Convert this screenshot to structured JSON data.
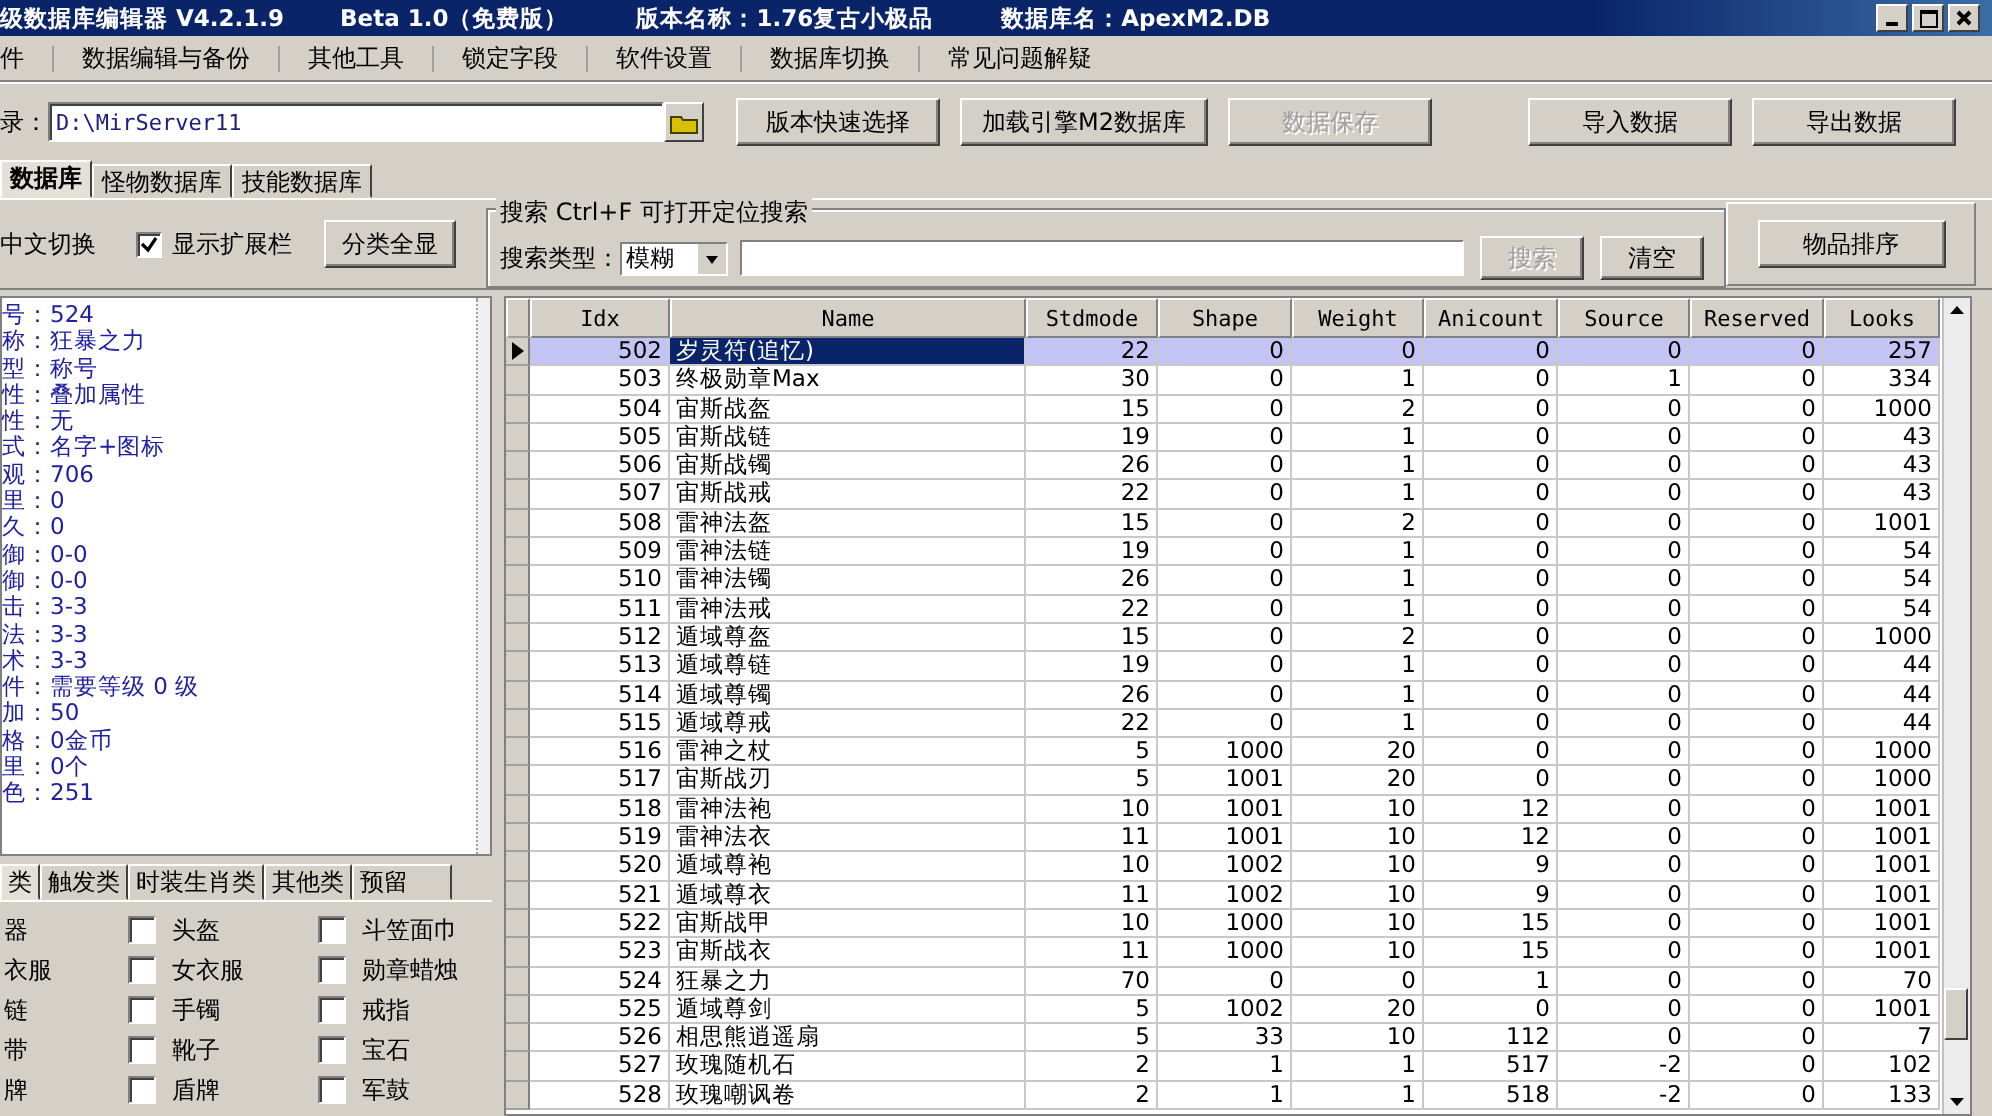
{
  "window": {
    "title_parts": [
      "级数据库编辑器 V4.2.1.9",
      "Beta 1.0（免费版）",
      "版本名称：1.76复古小极品",
      "数据库名：ApexM2.DB"
    ]
  },
  "menu": [
    "件",
    "数据编辑与备份",
    "其他工具",
    "锁定字段",
    "软件设置",
    "数据库切换",
    "常见问题解疑"
  ],
  "toolbar": {
    "path_label": "录：",
    "path_value": "D:\\MirServer11",
    "buttons": [
      {
        "label": "版本快速选择",
        "disabled": false
      },
      {
        "label": "加载引擎M2数据库",
        "disabled": false
      },
      {
        "label": "数据保存",
        "disabled": true
      }
    ],
    "right_buttons": [
      {
        "label": "导入数据",
        "disabled": false
      },
      {
        "label": "导出数据",
        "disabled": false
      }
    ]
  },
  "tabs": [
    {
      "label": "数据库",
      "selected": true
    },
    {
      "label": "怪物数据库",
      "selected": false
    },
    {
      "label": "技能数据库",
      "selected": false
    }
  ],
  "options": {
    "chinese_toggle": "中文切换",
    "show_ext": {
      "label": "显示扩展栏",
      "checked": true
    },
    "show_all_button": "分类全显"
  },
  "search": {
    "title": "搜索  Ctrl+F 可打开定位搜索",
    "type_label": "搜索类型：",
    "type_value": "模糊",
    "search_button": {
      "label": "搜索",
      "disabled": true
    },
    "clear_button": {
      "label": "清空",
      "disabled": false
    },
    "sort_button": "物品排序"
  },
  "info": [
    "号：524",
    "称：狂暴之力",
    "型：称号",
    "性：叠加属性",
    "性：无",
    "式：名字+图标",
    "观：706",
    "里：0",
    "久：0",
    "御：0-0",
    "御：0-0",
    "击：3-3",
    "法：3-3",
    "术：3-3",
    "件：需要等级 0 级",
    "加：50",
    "格：0金币",
    "里：0个",
    "色：251"
  ],
  "category_tabs": [
    {
      "label": "类",
      "selected": true
    },
    {
      "label": "触发类",
      "selected": false
    },
    {
      "label": "时装生肖类",
      "selected": false
    },
    {
      "label": "其他类",
      "selected": false
    },
    {
      "label": "预留",
      "selected": false
    }
  ],
  "categories": [
    {
      "label": "器"
    },
    {
      "label": "头盔",
      "checked": false
    },
    {
      "label": "斗笠面巾",
      "checked": false
    },
    {
      "label": "衣服"
    },
    {
      "label": "女衣服",
      "checked": false
    },
    {
      "label": "勋章蜡烛",
      "checked": false
    },
    {
      "label": "链"
    },
    {
      "label": "手镯",
      "checked": false
    },
    {
      "label": "戒指",
      "checked": false
    },
    {
      "label": "带"
    },
    {
      "label": "靴子",
      "checked": false
    },
    {
      "label": "宝石",
      "checked": false
    },
    {
      "label": "牌"
    },
    {
      "label": "盾牌",
      "checked": false
    },
    {
      "label": "军鼓",
      "checked": false
    }
  ],
  "table": {
    "columns": [
      "Idx",
      "Name",
      "Stdmode",
      "Shape",
      "Weight",
      "Anicount",
      "Source",
      "Reserved",
      "Looks"
    ],
    "rows": [
      {
        "selected": true,
        "cells": [
          "502",
          "岁灵符(追忆)",
          "22",
          "0",
          "0",
          "0",
          "0",
          "0",
          "257"
        ]
      },
      {
        "selected": false,
        "cells": [
          "503",
          "终极勋章Max",
          "30",
          "0",
          "1",
          "0",
          "1",
          "0",
          "334"
        ]
      },
      {
        "selected": false,
        "cells": [
          "504",
          "宙斯战盔",
          "15",
          "0",
          "2",
          "0",
          "0",
          "0",
          "1000"
        ]
      },
      {
        "selected": false,
        "cells": [
          "505",
          "宙斯战链",
          "19",
          "0",
          "1",
          "0",
          "0",
          "0",
          "43"
        ]
      },
      {
        "selected": false,
        "cells": [
          "506",
          "宙斯战镯",
          "26",
          "0",
          "1",
          "0",
          "0",
          "0",
          "43"
        ]
      },
      {
        "selected": false,
        "cells": [
          "507",
          "宙斯战戒",
          "22",
          "0",
          "1",
          "0",
          "0",
          "0",
          "43"
        ]
      },
      {
        "selected": false,
        "cells": [
          "508",
          "雷神法盔",
          "15",
          "0",
          "2",
          "0",
          "0",
          "0",
          "1001"
        ]
      },
      {
        "selected": false,
        "cells": [
          "509",
          "雷神法链",
          "19",
          "0",
          "1",
          "0",
          "0",
          "0",
          "54"
        ]
      },
      {
        "selected": false,
        "cells": [
          "510",
          "雷神法镯",
          "26",
          "0",
          "1",
          "0",
          "0",
          "0",
          "54"
        ]
      },
      {
        "selected": false,
        "cells": [
          "511",
          "雷神法戒",
          "22",
          "0",
          "1",
          "0",
          "0",
          "0",
          "54"
        ]
      },
      {
        "selected": false,
        "cells": [
          "512",
          "遁域尊盔",
          "15",
          "0",
          "2",
          "0",
          "0",
          "0",
          "1000"
        ]
      },
      {
        "selected": false,
        "cells": [
          "513",
          "遁域尊链",
          "19",
          "0",
          "1",
          "0",
          "0",
          "0",
          "44"
        ]
      },
      {
        "selected": false,
        "cells": [
          "514",
          "遁域尊镯",
          "26",
          "0",
          "1",
          "0",
          "0",
          "0",
          "44"
        ]
      },
      {
        "selected": false,
        "cells": [
          "515",
          "遁域尊戒",
          "22",
          "0",
          "1",
          "0",
          "0",
          "0",
          "44"
        ]
      },
      {
        "selected": false,
        "cells": [
          "516",
          "雷神之杖",
          "5",
          "1000",
          "20",
          "0",
          "0",
          "0",
          "1000"
        ]
      },
      {
        "selected": false,
        "cells": [
          "517",
          "宙斯战刃",
          "5",
          "1001",
          "20",
          "0",
          "0",
          "0",
          "1000"
        ]
      },
      {
        "selected": false,
        "cells": [
          "518",
          "雷神法袍",
          "10",
          "1001",
          "10",
          "12",
          "0",
          "0",
          "1001"
        ]
      },
      {
        "selected": false,
        "cells": [
          "519",
          "雷神法衣",
          "11",
          "1001",
          "10",
          "12",
          "0",
          "0",
          "1001"
        ]
      },
      {
        "selected": false,
        "cells": [
          "520",
          "遁域尊袍",
          "10",
          "1002",
          "10",
          "9",
          "0",
          "0",
          "1001"
        ]
      },
      {
        "selected": false,
        "cells": [
          "521",
          "遁域尊衣",
          "11",
          "1002",
          "10",
          "9",
          "0",
          "0",
          "1001"
        ]
      },
      {
        "selected": false,
        "cells": [
          "522",
          "宙斯战甲",
          "10",
          "1000",
          "10",
          "15",
          "0",
          "0",
          "1001"
        ]
      },
      {
        "selected": false,
        "cells": [
          "523",
          "宙斯战衣",
          "11",
          "1000",
          "10",
          "15",
          "0",
          "0",
          "1001"
        ]
      },
      {
        "selected": false,
        "cells": [
          "524",
          "狂暴之力",
          "70",
          "0",
          "0",
          "1",
          "0",
          "0",
          "70"
        ]
      },
      {
        "selected": false,
        "cells": [
          "525",
          "遁域尊剑",
          "5",
          "1002",
          "20",
          "0",
          "0",
          "0",
          "1001"
        ]
      },
      {
        "selected": false,
        "cells": [
          "526",
          "相思熊逍遥扇",
          "5",
          "33",
          "10",
          "112",
          "0",
          "0",
          "7"
        ]
      },
      {
        "selected": false,
        "cells": [
          "527",
          "玫瑰随机石",
          "2",
          "1",
          "1",
          "517",
          "-2",
          "0",
          "102"
        ]
      },
      {
        "selected": false,
        "cells": [
          "528",
          "玫瑰嘲讽卷",
          "2",
          "1",
          "1",
          "518",
          "-2",
          "0",
          "133"
        ]
      }
    ]
  }
}
